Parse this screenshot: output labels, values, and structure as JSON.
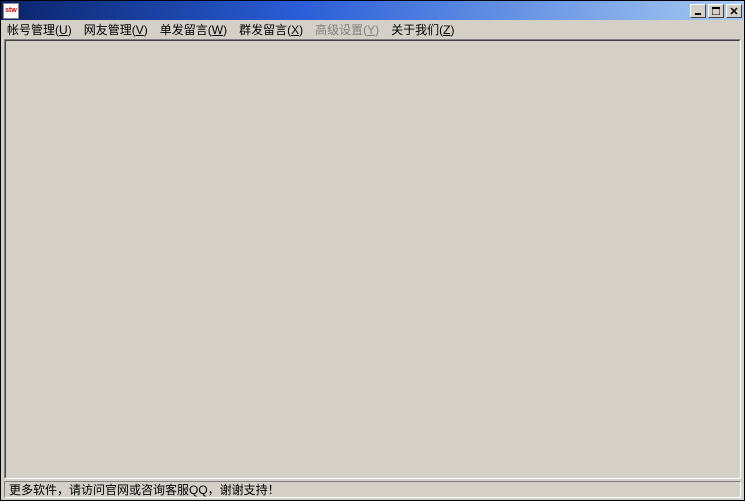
{
  "titlebar": {
    "icon_label": "stw",
    "title": ""
  },
  "window_controls": {
    "minimize_tip": "Minimize",
    "maximize_tip": "Maximize",
    "close_tip": "Close"
  },
  "menubar": {
    "items": [
      {
        "label": "帐号管理",
        "accel": "U",
        "enabled": true
      },
      {
        "label": "网友管理",
        "accel": "V",
        "enabled": true
      },
      {
        "label": "单发留言",
        "accel": "W",
        "enabled": true
      },
      {
        "label": "群发留言",
        "accel": "X",
        "enabled": true
      },
      {
        "label": "高级设置",
        "accel": "Y",
        "enabled": false
      },
      {
        "label": "关于我们",
        "accel": "Z",
        "enabled": true
      }
    ]
  },
  "statusbar": {
    "text": "更多软件，请访问官网或咨询客服QQ，谢谢支持！"
  }
}
